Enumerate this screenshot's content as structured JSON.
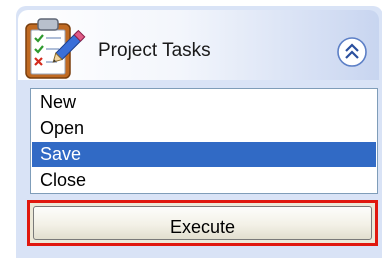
{
  "header": {
    "title": "Project Tasks",
    "icon": "clipboard-checklist-pencil-icon",
    "collapse_icon": "double-chevron-up-icon"
  },
  "list": {
    "items": [
      "New",
      "Open",
      "Save",
      "Close"
    ],
    "selected": "Save"
  },
  "execute_button": {
    "label": "Execute"
  },
  "colors": {
    "panel_background": "#d9e3f6",
    "selection": "#316ac5",
    "focus_outline": "#e0180e",
    "list_border": "#7f9db9"
  }
}
